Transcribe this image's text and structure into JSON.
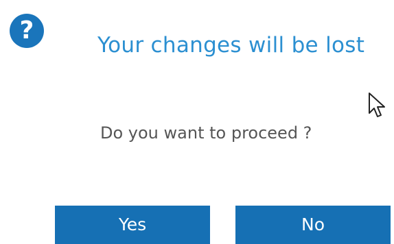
{
  "dialog": {
    "icon": "question-mark-icon",
    "icon_glyph": "?",
    "title": "Your changes will be lost",
    "message": "Do you want to proceed ?",
    "buttons": {
      "yes_label": "Yes",
      "no_label": "No"
    }
  },
  "colors": {
    "accent": "#1670b4",
    "title": "#2b8fd1",
    "message": "#555555"
  }
}
